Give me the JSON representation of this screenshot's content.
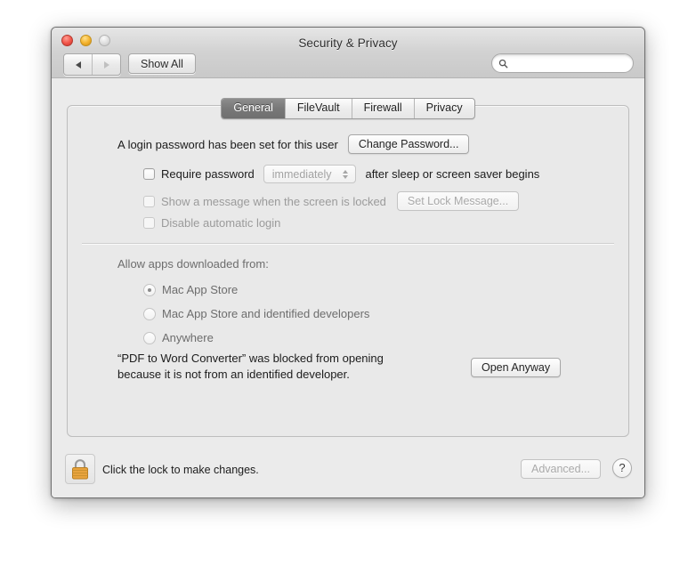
{
  "window": {
    "title": "Security & Privacy",
    "traffic_lights": [
      "close",
      "minimize",
      "zoom"
    ]
  },
  "toolbar": {
    "back_icon": "triangle-left-icon",
    "forward_icon": "triangle-right-icon",
    "show_all_label": "Show All",
    "search": {
      "icon": "search-icon",
      "value": "",
      "placeholder": ""
    }
  },
  "tabs": [
    {
      "label": "General",
      "selected": true
    },
    {
      "label": "FileVault",
      "selected": false
    },
    {
      "label": "Firewall",
      "selected": false
    },
    {
      "label": "Privacy",
      "selected": false
    }
  ],
  "general": {
    "password_status": "A login password has been set for this user",
    "change_password_button": "Change Password...",
    "require_password": {
      "checked": false,
      "label": "Require password",
      "interval_value": "immediately",
      "suffix": "after sleep or screen saver begins"
    },
    "show_message": {
      "checked": false,
      "label": "Show a message when the screen is locked",
      "button": "Set Lock Message...",
      "disabled": true
    },
    "disable_auto_login": {
      "checked": false,
      "label": "Disable automatic login",
      "disabled": true
    },
    "allow_apps": {
      "heading": "Allow apps downloaded from:",
      "options": [
        {
          "label": "Mac App Store",
          "selected": true
        },
        {
          "label": "Mac App Store and identified developers",
          "selected": false
        },
        {
          "label": "Anywhere",
          "selected": false
        }
      ]
    },
    "blocked_notice": {
      "text": "“PDF to Word Converter” was blocked from opening\nbecause it is not from an identified developer.",
      "button": "Open Anyway"
    }
  },
  "bottom": {
    "lock_icon": "lock-closed-icon",
    "lock_caption": "Click the lock to make changes.",
    "advanced_button": "Advanced...",
    "help_button": "?"
  },
  "colors": {
    "accent_selected_tab": "#787878",
    "lock_gold": "#e8a33d",
    "window_bg": "#ebebeb",
    "panel_bg": "#e9e9e9"
  }
}
